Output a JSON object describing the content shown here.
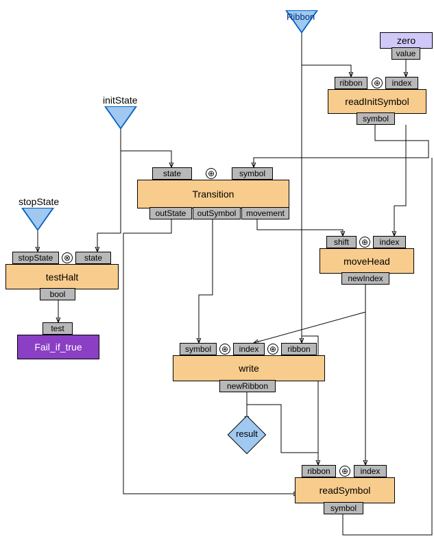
{
  "inputs": {
    "ribbon_label": "Ribbon",
    "initState_label": "initState",
    "stopState_label": "stopState",
    "zero_label": "zero",
    "zero_value_port": "value"
  },
  "readInitSymbol": {
    "title": "readInitSymbol",
    "in_ribbon": "ribbon",
    "in_index": "index",
    "out_symbol": "symbol",
    "op": "⊕"
  },
  "transition": {
    "title": "Transition",
    "in_state": "state",
    "in_symbol": "symbol",
    "out_outState": "outState",
    "out_outSymbol": "outSymbol",
    "out_movement": "movement",
    "op": "⊕"
  },
  "testHalt": {
    "title": "testHalt",
    "in_stopState": "stopState",
    "in_state": "state",
    "out_bool": "bool",
    "op": "⊗"
  },
  "failIfTrue": {
    "title": "Fail_if_true",
    "in_test": "test"
  },
  "moveHead": {
    "title": "moveHead",
    "in_shift": "shift",
    "in_index": "index",
    "out_newIndex": "newIndex",
    "op": "⊕"
  },
  "write": {
    "title": "write",
    "in_symbol": "symbol",
    "in_index": "index",
    "in_ribbon": "ribbon",
    "out_newRibbon": "newRibbon",
    "op1": "⊕",
    "op2": "⊕"
  },
  "result": {
    "label": "result"
  },
  "readSymbol": {
    "title": "readSymbol",
    "in_ribbon": "ribbon",
    "in_index": "index",
    "out_symbol": "symbol",
    "op": "⊕"
  }
}
